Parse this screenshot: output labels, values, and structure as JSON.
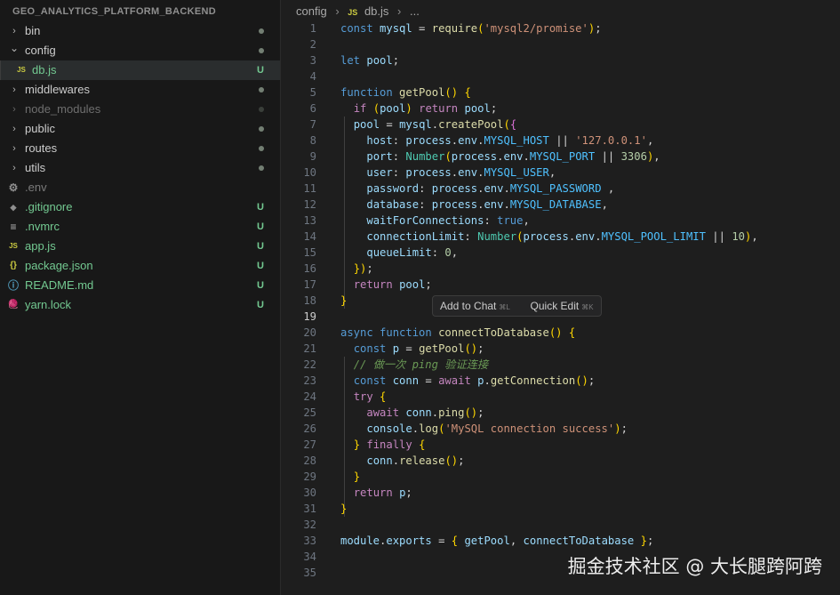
{
  "explorer": {
    "title": "GEO_ANALYTICS_PLATFORM_BACKEND",
    "items": [
      {
        "label": "bin",
        "icon_text": "",
        "badge": "",
        "twisty": "›"
      },
      {
        "label": "config",
        "icon_text": "",
        "badge": "",
        "twisty": "⌄"
      },
      {
        "label": "db.js",
        "icon_text": "JS",
        "badge": "U",
        "twisty": ""
      },
      {
        "label": "middlewares",
        "icon_text": "",
        "badge": "",
        "twisty": "›"
      },
      {
        "label": "node_modules",
        "icon_text": "",
        "badge": "",
        "twisty": "›"
      },
      {
        "label": "public",
        "icon_text": "",
        "badge": "",
        "twisty": "›"
      },
      {
        "label": "routes",
        "icon_text": "",
        "badge": "",
        "twisty": "›"
      },
      {
        "label": "utils",
        "icon_text": "",
        "badge": "",
        "twisty": "›"
      },
      {
        "label": ".env",
        "icon_text": "⚙",
        "badge": "",
        "twisty": ""
      },
      {
        "label": ".gitignore",
        "icon_text": "◆",
        "badge": "U",
        "twisty": ""
      },
      {
        "label": ".nvmrc",
        "icon_text": "≡",
        "badge": "U",
        "twisty": ""
      },
      {
        "label": "app.js",
        "icon_text": "JS",
        "badge": "U",
        "twisty": ""
      },
      {
        "label": "package.json",
        "icon_text": "{}",
        "badge": "U",
        "twisty": ""
      },
      {
        "label": "README.md",
        "icon_text": "ⓘ",
        "badge": "U",
        "twisty": ""
      },
      {
        "label": "yarn.lock",
        "icon_text": "🧶",
        "badge": "U",
        "twisty": ""
      }
    ]
  },
  "breadcrumb": {
    "folder": "config",
    "sep": "›",
    "file_icon": "JS",
    "file": "db.js",
    "rest": "..."
  },
  "line_numbers": [
    "1",
    "2",
    "3",
    "4",
    "5",
    "6",
    "7",
    "8",
    "9",
    "10",
    "11",
    "12",
    "13",
    "14",
    "15",
    "16",
    "17",
    "18",
    "19",
    "20",
    "21",
    "22",
    "23",
    "24",
    "25",
    "26",
    "27",
    "28",
    "29",
    "30",
    "31",
    "32",
    "33",
    "34",
    "35"
  ],
  "code": [
    "const mysql = require('mysql2/promise');",
    "",
    "let pool;",
    "",
    "function getPool() {",
    "  if (pool) return pool;",
    "  pool = mysql.createPool({",
    "    host: process.env.MYSQL_HOST || '127.0.0.1',",
    "    port: Number(process.env.MYSQL_PORT || 3306),",
    "    user: process.env.MYSQL_USER,",
    "    password: process.env.MYSQL_PASSWORD ,",
    "    database: process.env.MYSQL_DATABASE,",
    "    waitForConnections: true,",
    "    connectionLimit: Number(process.env.MYSQL_POOL_LIMIT || 10),",
    "    queueLimit: 0,",
    "  });",
    "  return pool;",
    "}",
    "",
    "async function connectToDatabase() {",
    "  const p = getPool();",
    "  // 做一次 ping 验证连接",
    "  const conn = await p.getConnection();",
    "  try {",
    "    await conn.ping();",
    "    console.log('MySQL connection success');",
    "  } finally {",
    "    conn.release();",
    "  }",
    "  return p;",
    "}",
    "",
    "module.exports = { getPool, connectToDatabase };",
    "",
    ""
  ],
  "popup": {
    "add_to_chat": "Add to Chat",
    "add_to_chat_key": "⌘L",
    "quick_edit": "Quick Edit",
    "quick_edit_key": "⌘K"
  },
  "watermark": "掘金技术社区 @ 大长腿跨阿跨"
}
